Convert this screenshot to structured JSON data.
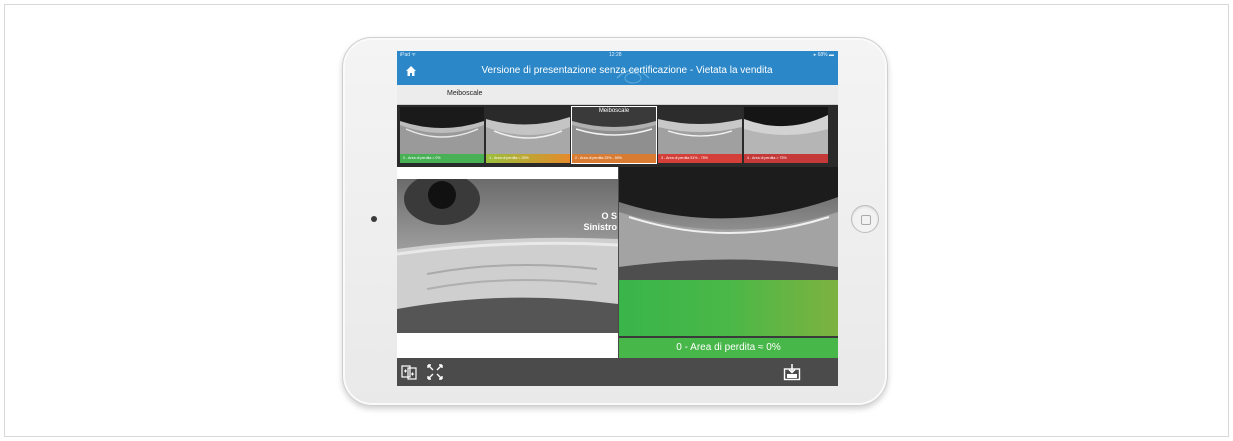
{
  "device": {
    "statusbar": {
      "carrier": "iPad ᯤ",
      "time": "12:28",
      "battery": "▸ 68% ▬"
    }
  },
  "app": {
    "title": "Versione di presentazione senza certificazione - Vietata la vendita",
    "section_label": "Meiboscale",
    "brand_color": "#2b87c7"
  },
  "scale": {
    "selected_index": 2,
    "selected_label": "Meiboscale",
    "grades": [
      {
        "label": "0 - Area di perdita ≈ 0%",
        "color": "#39b54a"
      },
      {
        "label": "1 - Area di perdita < 25%",
        "color": "#e58a2a"
      },
      {
        "label": "2 - Area di perdita 25% - 50%",
        "color": "#e07a2a"
      },
      {
        "label": "3 - Area di perdita 51% - 75%",
        "color": "#d9352e"
      },
      {
        "label": "4 - Area di perdita > 75%",
        "color": "#c62b2b"
      }
    ]
  },
  "left_view": {
    "eye_label_line1": "O S",
    "eye_label_line2": "Sinistro"
  },
  "right_view": {
    "result_text": "0 - Area di perdita ≈ 0%",
    "result_color": "#47b749"
  },
  "toolbar": {
    "icons": [
      "compare-icon",
      "fullscreen-icon",
      "save-icon"
    ]
  }
}
